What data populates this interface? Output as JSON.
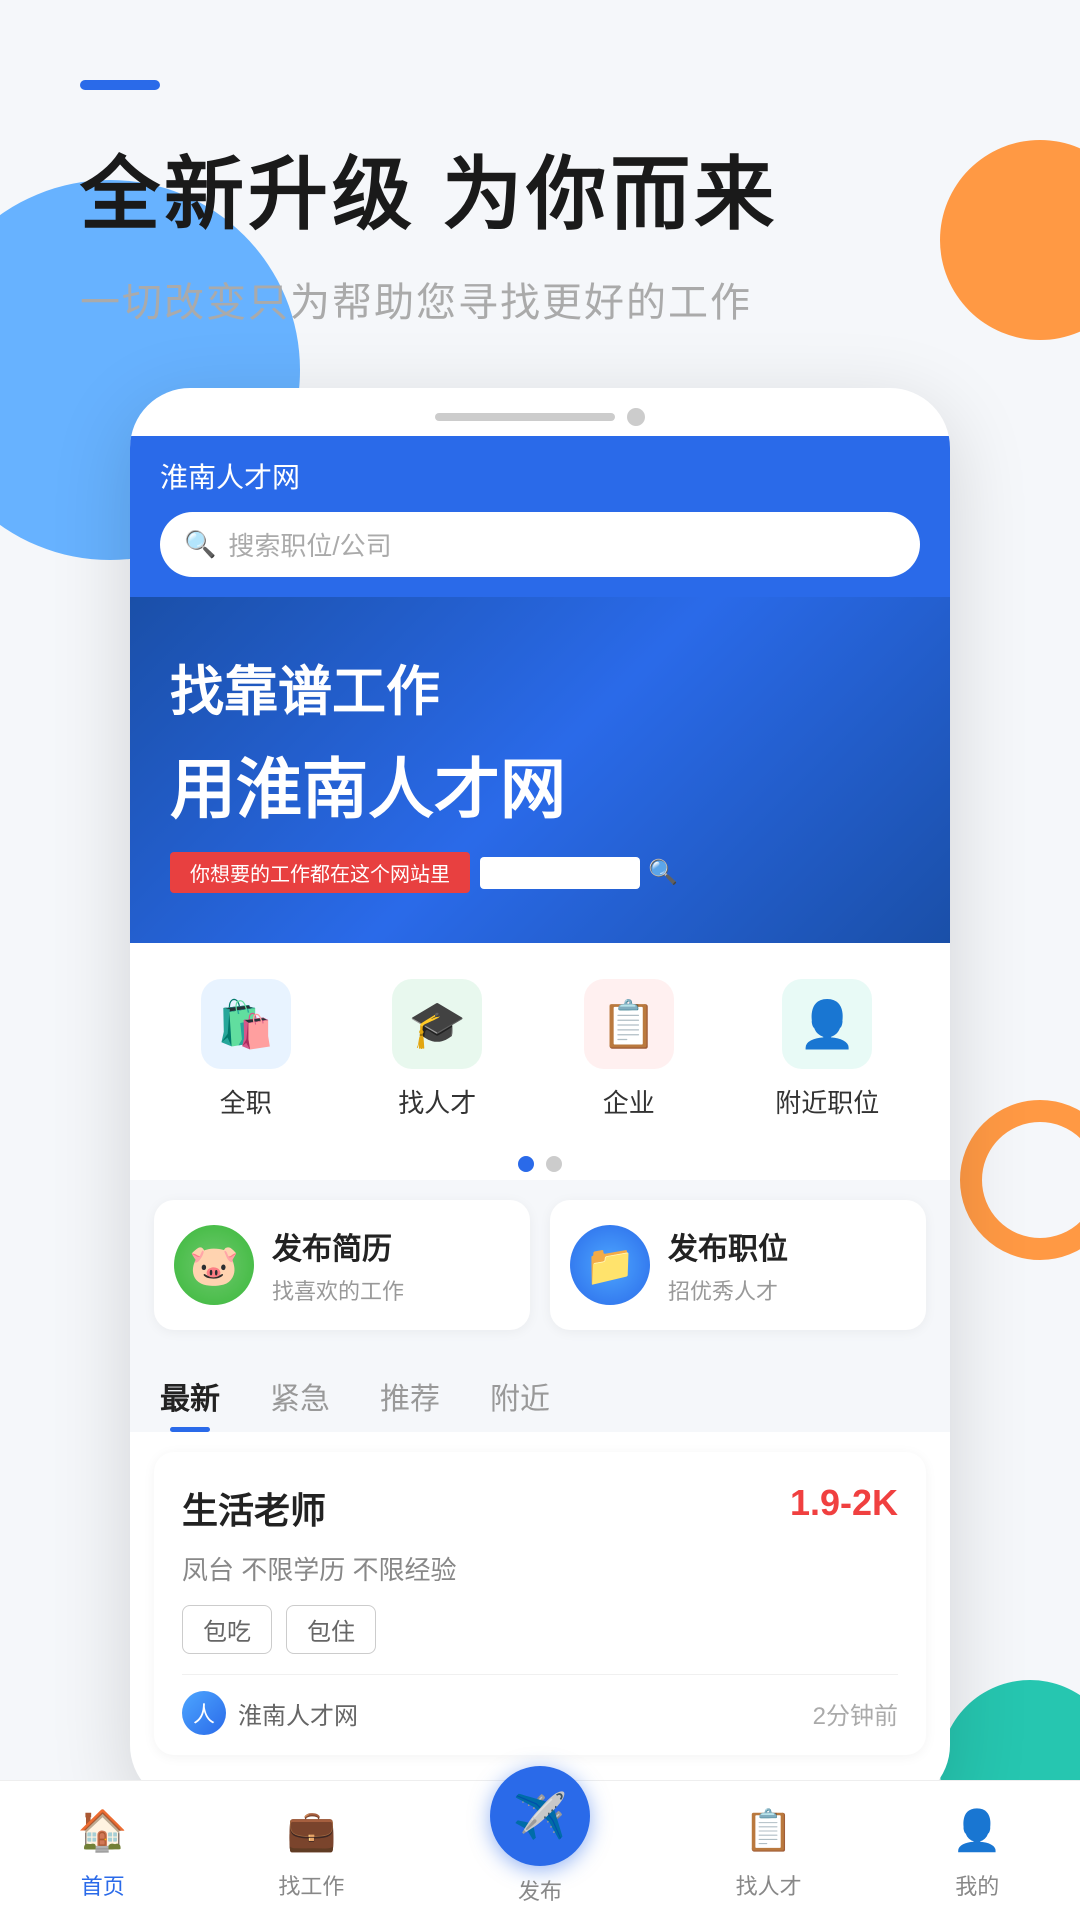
{
  "app": {
    "title": "淮南人才网"
  },
  "header": {
    "dash": "",
    "main_title": "全新升级 为你而来",
    "sub_title": "一切改变只为帮助您寻找更好的工作",
    "search_placeholder": "搜索职位/公司"
  },
  "banner": {
    "line1": "找靠谱工作",
    "line2": "用淮南人才网",
    "sub_text": "你想要的工作都在这个网站里"
  },
  "categories": [
    {
      "label": "全职",
      "icon": "🛍️",
      "color_class": "cat-blue"
    },
    {
      "label": "找人才",
      "icon": "🎓",
      "color_class": "cat-green"
    },
    {
      "label": "企业",
      "icon": "📋",
      "color_class": "cat-red"
    },
    {
      "label": "附近职位",
      "icon": "👤",
      "color_class": "cat-teal"
    }
  ],
  "action_cards": [
    {
      "icon": "🐷",
      "icon_class": "action-icon-green",
      "title": "发布简历",
      "subtitle": "找喜欢的工作"
    },
    {
      "icon": "📁",
      "icon_class": "action-icon-blue",
      "title": "发布职位",
      "subtitle": "招优秀人才"
    }
  ],
  "tabs": [
    {
      "label": "最新",
      "active": true
    },
    {
      "label": "紧急",
      "active": false
    },
    {
      "label": "推荐",
      "active": false
    },
    {
      "label": "附近",
      "active": false
    }
  ],
  "job_card": {
    "title": "生活老师",
    "salary": "1.9-2K",
    "info": "凤台   不限学历   不限经验",
    "tags": [
      "包吃",
      "包住"
    ],
    "company_name": "淮南人才网",
    "post_time": "2分钟前"
  },
  "bottom_nav": [
    {
      "label": "首页",
      "icon": "🏠",
      "active": true
    },
    {
      "label": "找工作",
      "icon": "💼",
      "active": false
    },
    {
      "label": "发布",
      "icon": "✈️",
      "active": false,
      "is_publish": true
    },
    {
      "label": "找人才",
      "icon": "📋",
      "active": false
    },
    {
      "label": "我的",
      "icon": "👤",
      "active": false
    }
  ]
}
